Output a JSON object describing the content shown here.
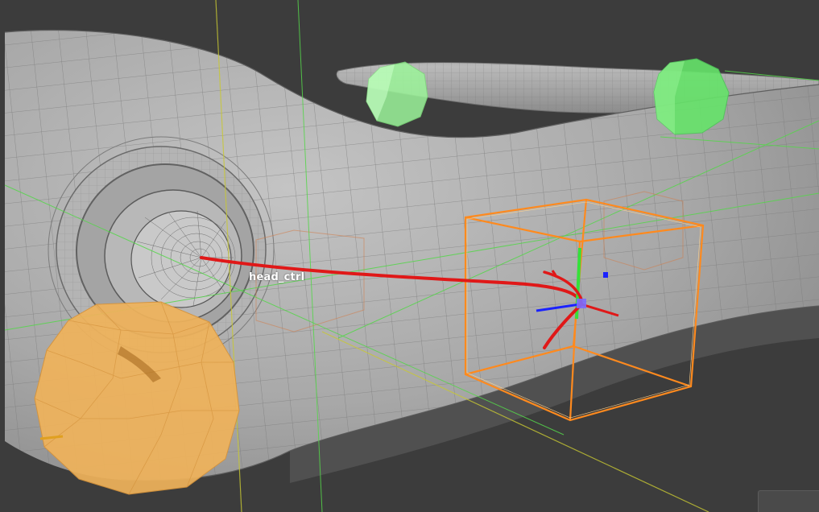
{
  "viewport": {
    "selected_control_label": "head_ctrl"
  },
  "colors": {
    "background": "#3c3c3c",
    "mesh_fill": "#a9a9a9",
    "wire": "#7a7a7a",
    "selection_orange": "#ff8a1e",
    "aim_curve_red": "#e01818",
    "control_green": "#7de87d",
    "control_orange": "#f2b35a",
    "axis_blue": "#1a22ff"
  }
}
